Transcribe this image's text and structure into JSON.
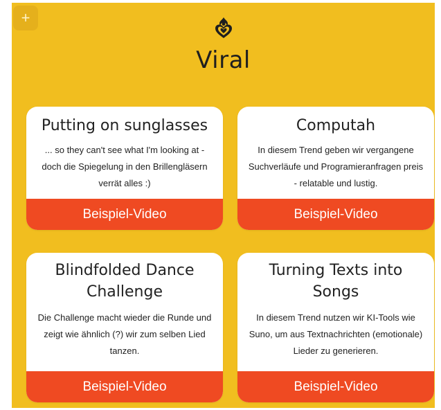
{
  "add_button": {
    "label": "+"
  },
  "header": {
    "title": "Viral",
    "icon": "flaming-heart-icon"
  },
  "colors": {
    "background": "#f1be1f",
    "card": "#ffffff",
    "button": "#ef4a22",
    "button_text": "#ffffff"
  },
  "cards": [
    {
      "title": "Putting on sunglasses",
      "text": "... so they can't see what I'm looking at - doch die Spiegelung in den Brillengläsern verrät alles :)",
      "button": "Beispiel-Video"
    },
    {
      "title": "Computah",
      "text": "In diesem Trend geben wir vergangene Suchverläufe und Programieranfragen preis - relatable und lustig.",
      "button": "Beispiel-Video"
    },
    {
      "title": "Blindfolded Dance Challenge",
      "text": "Die Challenge macht wieder die Runde und zeigt wie ähnlich (?) wir zum selben Lied tanzen.",
      "button": "Beispiel-Video"
    },
    {
      "title": "Turning Texts into Songs",
      "text": "In diesem Trend nutzen wir KI-Tools wie Suno, um aus Textnachrichten (emotionale) Lieder zu generieren.",
      "button": "Beispiel-Video"
    }
  ]
}
